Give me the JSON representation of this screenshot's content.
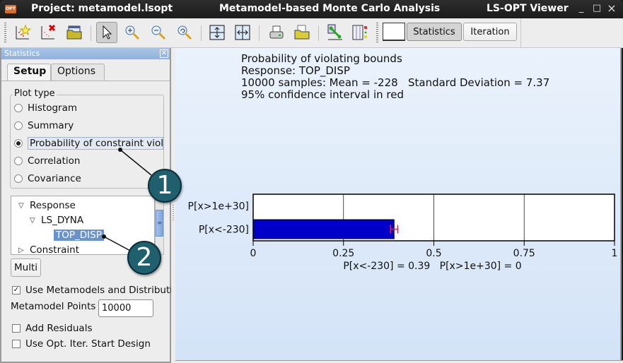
{
  "window": {
    "project_title": "Project: metamodel.lsopt",
    "main_title": "Metamodel-based Monte Carlo Analysis",
    "app_title": "LS-OPT Viewer",
    "app_icon_text": "OPT",
    "controls": {
      "minimize": "_",
      "maximize": "□",
      "close": "×"
    }
  },
  "toolbar": {
    "icons": [
      "new-plot-icon",
      "delete-plot-icon",
      "open-folder-icon",
      "pointer-icon",
      "zoom-in-icon",
      "zoom-out-icon",
      "zoom-reset-icon",
      "fit-vertical-icon",
      "fit-horizontal-icon",
      "print-icon",
      "export-folder-icon",
      "connect-icon",
      "table-legend-icon"
    ],
    "statistics_label": "Statistics",
    "iteration_label": "Iteration"
  },
  "panel": {
    "title": "Statistics",
    "tabs": [
      {
        "label": "Setup",
        "active": true
      },
      {
        "label": "Options",
        "active": false
      }
    ],
    "plot_type": {
      "title": "Plot type",
      "options": [
        {
          "label": "Histogram",
          "selected": false
        },
        {
          "label": "Summary",
          "selected": false
        },
        {
          "label": "Probability of constraint violation",
          "selected": true
        },
        {
          "label": "Correlation",
          "selected": false
        },
        {
          "label": "Covariance",
          "selected": false
        }
      ]
    },
    "tree": {
      "response": "Response",
      "ls_dyna": "LS_DYNA",
      "top_disp": "TOP_DISP",
      "constraint": "Constraint"
    },
    "multi_label": "Multi",
    "use_metamodels": {
      "label": "Use Metamodels and Distributions",
      "checked": true
    },
    "metamodel_points": {
      "label": "Metamodel Points",
      "value": "10000"
    },
    "add_residuals": {
      "label": "Add Residuals",
      "checked": false
    },
    "use_start_design": {
      "label": "Use Opt. Iter. Start Design",
      "checked": false
    }
  },
  "plot": {
    "info_lines": [
      "Probability of violating bounds",
      "Response: TOP_DISP",
      "10000 samples: Mean = -228   Standard Deviation = 7.37",
      "95% confidence interval in red"
    ]
  },
  "callouts": [
    "1",
    "2"
  ],
  "chart_data": {
    "type": "bar",
    "orientation": "horizontal",
    "categories": [
      "P[x>1e+30]",
      "P[x<-230]"
    ],
    "values": [
      0,
      0.39
    ],
    "error_bars": [
      null,
      {
        "low": 0.38,
        "high": 0.4,
        "color": "#e0204a"
      }
    ],
    "bar_color": "#0000c8",
    "xlim": [
      0,
      1
    ],
    "xticks": [
      0,
      0.25,
      0.5,
      0.75,
      1
    ],
    "xtick_labels": [
      "0",
      "0.25",
      "0.5",
      "0.75",
      "1"
    ],
    "grid": true,
    "summary_label": "P[x<-230] = 0.39   P[x>1e+30] = 0"
  }
}
